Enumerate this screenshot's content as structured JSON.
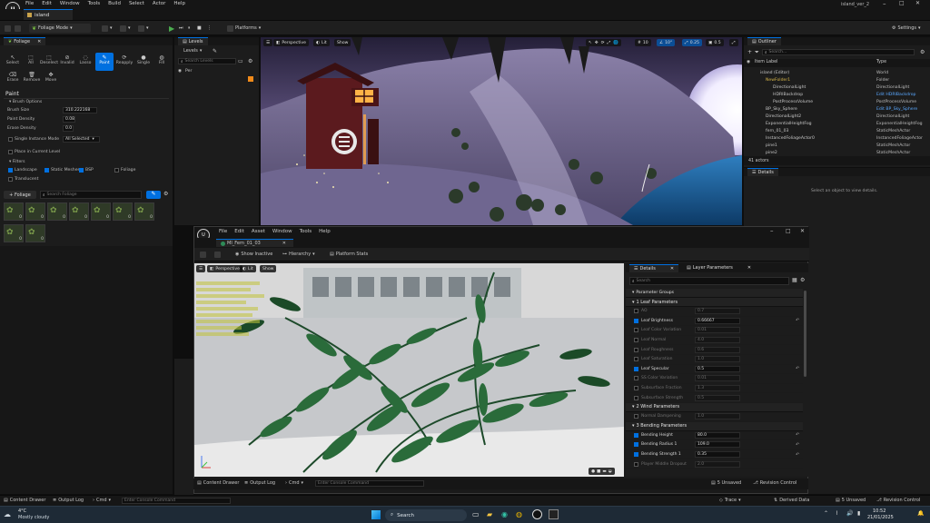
{
  "app": {
    "menu": [
      "File",
      "Edit",
      "Window",
      "Tools",
      "Build",
      "Select",
      "Actor",
      "Help"
    ],
    "project_name": "island_ver_2",
    "level_tab": "island"
  },
  "toolbar": {
    "mode": "Foliage Mode",
    "platforms": "Platforms",
    "settings": "Settings"
  },
  "foliage_panel": {
    "title": "Foliage",
    "tools": [
      "Select",
      "All",
      "Deselect",
      "Invalid",
      "Lasso",
      "Paint",
      "Reapply",
      "Single",
      "Fill",
      "Erase",
      "Remove",
      "Move"
    ],
    "active_tool": "Paint",
    "section": "Paint",
    "brush_options_header": "Brush Options",
    "brush_size_label": "Brush Size",
    "brush_size_value": "310.222168",
    "paint_density_label": "Paint Density",
    "paint_density_value": "0.08",
    "erase_density_label": "Erase Density",
    "erase_density_value": "0.0",
    "single_instance_label": "Single Instance Mode",
    "single_instance_value": "All Selected",
    "place_current_level": "Place in Current Level",
    "filters_header": "Filters",
    "filters": [
      "Landscape",
      "Static Meshes",
      "BSP",
      "Foliage",
      "Translucent"
    ],
    "add_foliage": "+ Foliage",
    "search_placeholder": "Search Foliage",
    "thumb_count": "0"
  },
  "levels_panel": {
    "title": "Levels",
    "dropdown": "Levels",
    "search_placeholder": "Search Levels",
    "row": "Per"
  },
  "viewport": {
    "perspective": "Perspective",
    "lit": "Lit",
    "show": "Show",
    "grid_value": "10",
    "angle_value": "10°",
    "scale_value": "0.25",
    "camera_value": "0.5"
  },
  "outliner": {
    "title": "Outliner",
    "search_placeholder": "Search...",
    "col_label": "Item Label",
    "col_type": "Type",
    "rows": [
      {
        "name": "island (Editor)",
        "type": "World"
      },
      {
        "name": "NewFolder1",
        "type": "Folder"
      },
      {
        "name": "DirectionalLight",
        "type": "DirectionalLight"
      },
      {
        "name": "HDRIBackdrop",
        "type": "Edit HDRIBackdrop"
      },
      {
        "name": "PostProcessVolume",
        "type": "PostProcessVolume"
      },
      {
        "name": "BP_Sky_Sphere",
        "type": "Edit BP_Sky_Sphere"
      },
      {
        "name": "DirectionalLight2",
        "type": "DirectionalLight"
      },
      {
        "name": "ExponentialHeightFog",
        "type": "ExponentialHeightFog"
      },
      {
        "name": "fern_01_03",
        "type": "StaticMeshActor"
      },
      {
        "name": "InstancedFoliageActor0",
        "type": "InstancedFoliageActor"
      },
      {
        "name": "pine1",
        "type": "StaticMeshActor"
      },
      {
        "name": "pine2",
        "type": "StaticMeshActor"
      }
    ],
    "actor_count": "41 actors"
  },
  "details_main": {
    "title": "Details",
    "empty_text": "Select an object to view details."
  },
  "material_editor": {
    "menu": [
      "File",
      "Edit",
      "Asset",
      "Window",
      "Tools",
      "Help"
    ],
    "tab": "MI_Fern_01_03",
    "show_inactive": "Show Inactive",
    "hierarchy": "Hierarchy",
    "platform_stats": "Platform Stats",
    "perspective": "Perspective",
    "lit": "Lit",
    "show": "Show",
    "details_tab": "Details",
    "layer_tab": "Layer Parameters",
    "search_placeholder": "Search",
    "parameter_groups": "Parameter Groups",
    "groups": [
      {
        "name": "1 Leaf Parameters",
        "params": [
          {
            "name": "AO",
            "value": "0.7",
            "on": false,
            "reset": false
          },
          {
            "name": "Leaf Brightness",
            "value": "0.66667",
            "on": true,
            "reset": true
          },
          {
            "name": "Leaf Color Variation",
            "value": "0.01",
            "on": false,
            "reset": false
          },
          {
            "name": "Leaf Normal",
            "value": "4.0",
            "on": false,
            "reset": false
          },
          {
            "name": "Leaf Roughness",
            "value": "0.6",
            "on": false,
            "reset": false
          },
          {
            "name": "Leaf Saturation",
            "value": "1.0",
            "on": false,
            "reset": false
          },
          {
            "name": "Leaf Specular",
            "value": "0.5",
            "on": true,
            "reset": true
          },
          {
            "name": "SS Color Variation",
            "value": "0.01",
            "on": false,
            "reset": false
          },
          {
            "name": "Subsurface Fraction",
            "value": "1.3",
            "on": false,
            "reset": false
          },
          {
            "name": "Subsurface Strength",
            "value": "0.5",
            "on": false,
            "reset": false
          }
        ]
      },
      {
        "name": "2 Wind Parameters",
        "params": [
          {
            "name": "Normal Dampening",
            "value": "1.0",
            "on": false,
            "reset": false
          }
        ]
      },
      {
        "name": "3 Bending Parameters",
        "params": [
          {
            "name": "Bending Height",
            "value": "80.0",
            "on": true,
            "reset": true
          },
          {
            "name": "Bending Radius 1",
            "value": "109.0",
            "on": true,
            "reset": true
          },
          {
            "name": "Bending Strength 1",
            "value": "0.35",
            "on": true,
            "reset": true
          },
          {
            "name": "Player Middle Dropout",
            "value": "2.0",
            "on": false,
            "reset": false
          }
        ]
      }
    ],
    "content_drawer": "Content Drawer",
    "output_log": "Output Log",
    "cmd": "Cmd",
    "console_placeholder": "Enter Console Command",
    "unsaved": "5 Unsaved",
    "revision": "Revision Control"
  },
  "status_bar": {
    "content_drawer": "Content Drawer",
    "output_log": "Output Log",
    "cmd": "Cmd",
    "console_placeholder": "Enter Console Command",
    "trace": "Trace",
    "derived_data": "Derived Data",
    "unsaved": "5 Unsaved",
    "revision": "Revision Control"
  },
  "taskbar": {
    "temp": "4°C",
    "weather": "Mostly cloudy",
    "search": "Search",
    "time": "10:52",
    "date": "21/01/2025"
  },
  "colors": {
    "accent": "#0070e0",
    "panel": "#1c1c1c",
    "taskbar": "#1e2a36",
    "play": "#4caf50"
  }
}
